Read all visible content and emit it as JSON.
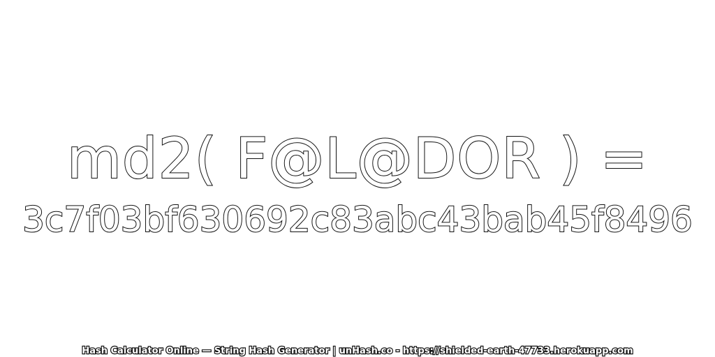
{
  "expression": "md2( F@L@DOR ) =",
  "hash": "3c7f03bf630692c83abc43bab45f8496",
  "footer": "Hash Calculator Online — String Hash Generator | unHash.co - https://shielded-earth-47733.herokuapp.com",
  "colors": {
    "background": "#ffffff",
    "text_fill": "#ffffff",
    "text_outline": "#111111"
  }
}
